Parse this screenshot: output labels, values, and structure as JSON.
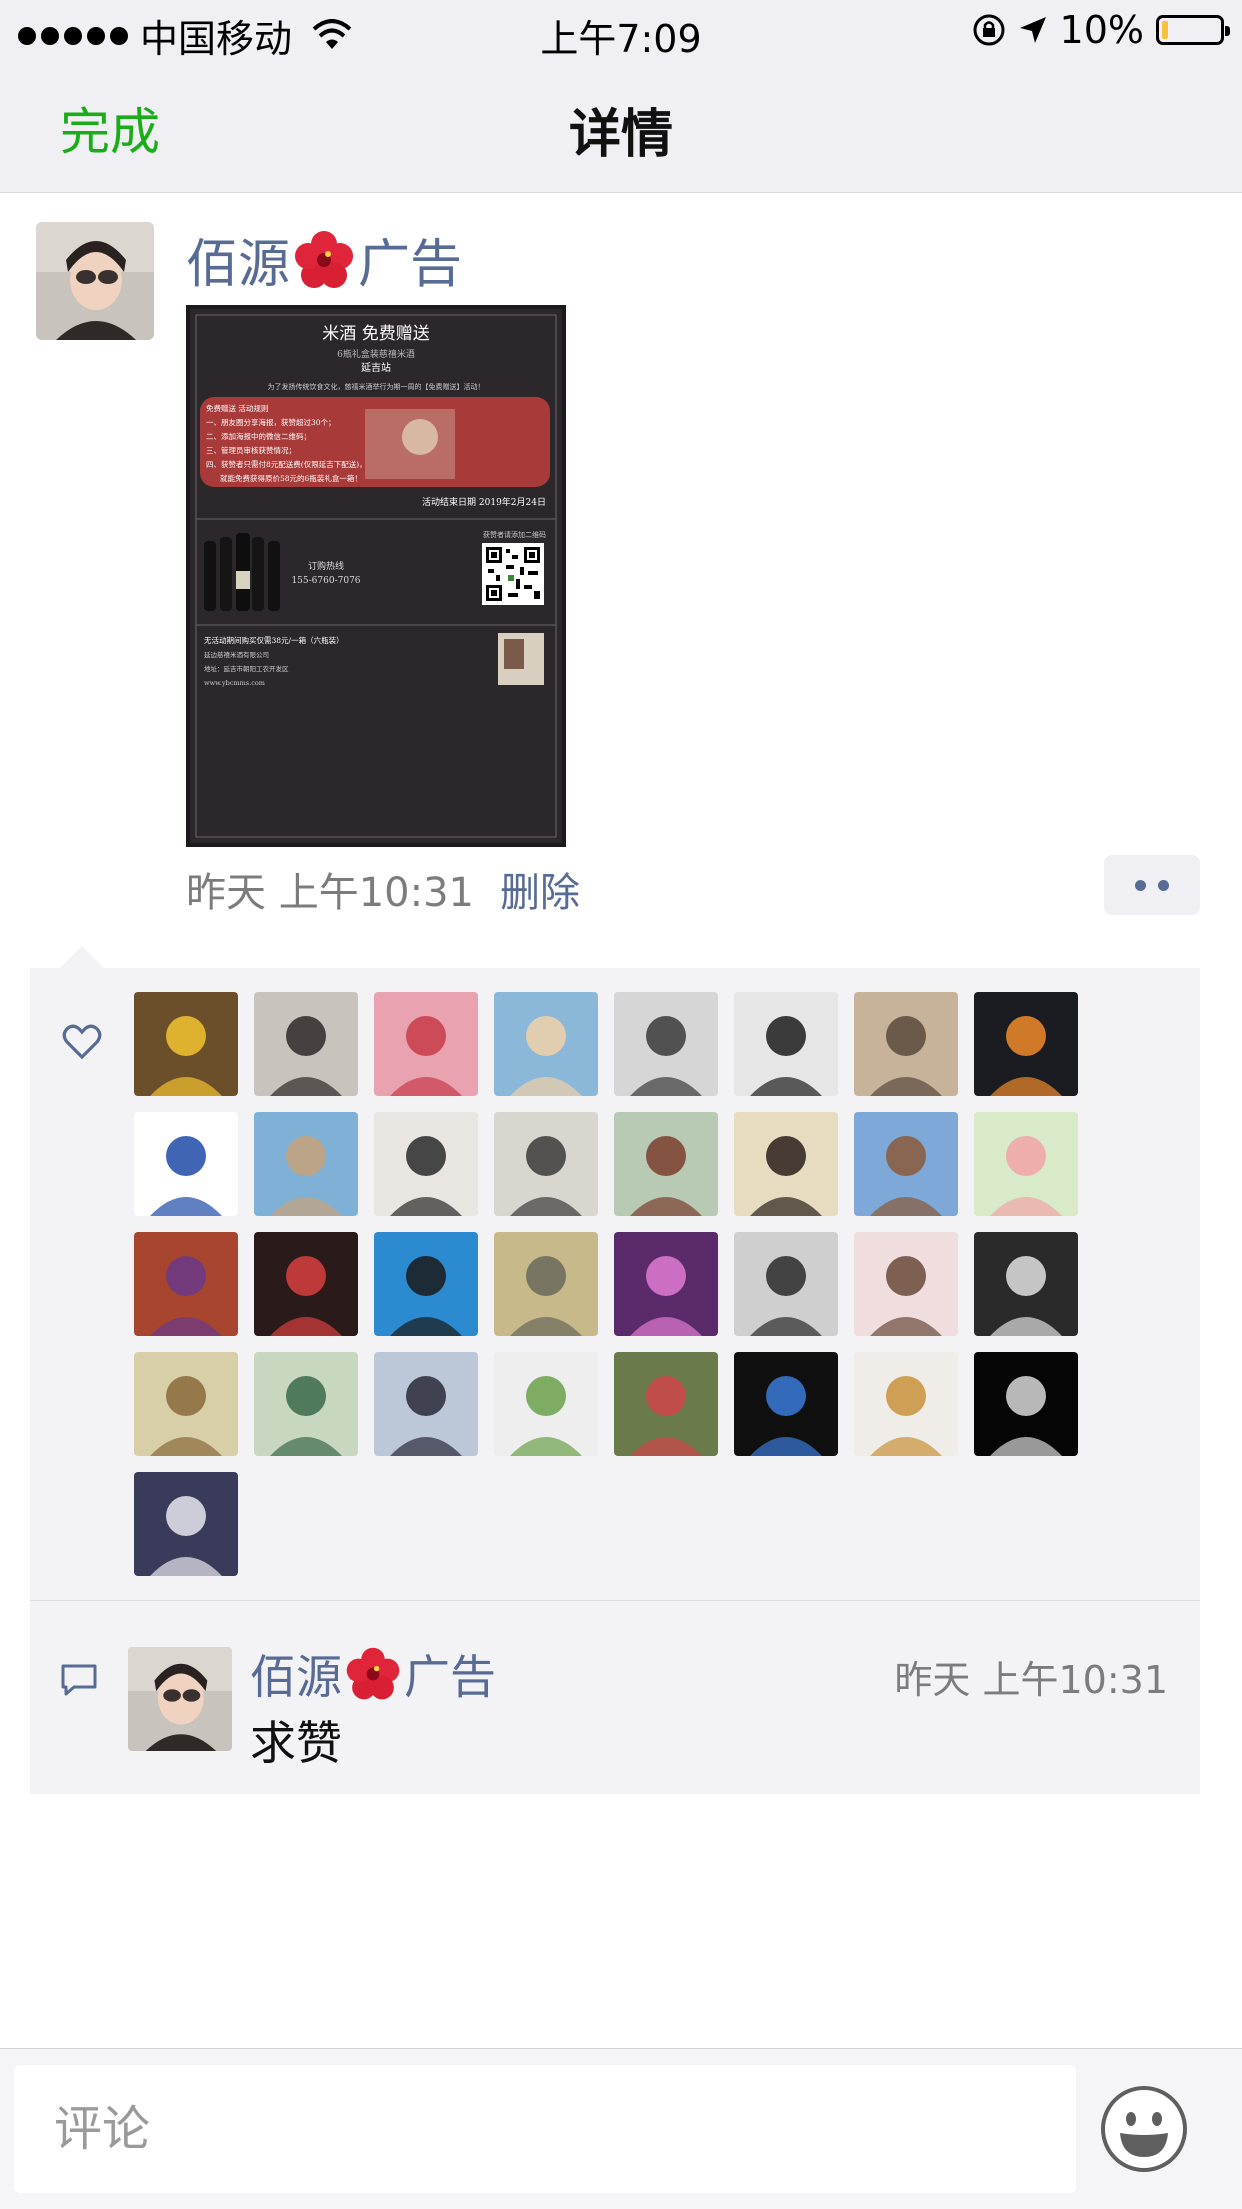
{
  "status_bar": {
    "carrier": "中国移动",
    "time": "上午7:09",
    "battery_percent": "10%",
    "battery_level": 0.1,
    "battery_color": "#f6c23b"
  },
  "nav": {
    "done_label": "完成",
    "title": "详情"
  },
  "post": {
    "author": {
      "name_part1": "佰源",
      "name_part2": "广告"
    },
    "poster_text": {
      "title": "米酒 免费赠送",
      "subtitle": "6瓶礼盒装慈禧米酒",
      "location": "延吉站",
      "intro": "为了发扬传统饮食文化，慈禧米酒举行为期一周的【免费赠送】活动！",
      "rules_title": "免费赠送 活动规则",
      "rule1": "一、朋友圈分享海报，获赞超过30个；",
      "rule2": "二、添加海报中的微信二维码；",
      "rule3": "三、管理员审核获赞情况；",
      "rule4": "四、获赞者只需付8元配送费(仅限延吉下配送)，",
      "rule5": "就能免费获得原价58元的6瓶装礼盒一箱！",
      "end_date": "活动结束日期 2019年2月24日",
      "qr_caption": "获赞者请添加二维码",
      "hotline_label": "订购热线",
      "hotline": "155-6760-7076",
      "bottom_line1": "无活动期间购买仅需38元/一箱（六瓶装）",
      "bottom_line2": "延边慈禧米酒有限公司",
      "bottom_line3": "地址：延吉市朝阳工农开发区",
      "website": "www.ybcmms.com"
    },
    "time": "昨天 上午10:31",
    "delete_label": "删除"
  },
  "likes": {
    "avatar_colors": [
      [
        "#6b4f2a",
        "#f2c230"
      ],
      [
        "#c9c3bd",
        "#2f2a28"
      ],
      [
        "#e8a2b0",
        "#c83b4a"
      ],
      [
        "#8bb8d8",
        "#f0d0a8"
      ],
      [
        "#d6d6d6",
        "#3a3a3a"
      ],
      [
        "#e6e6e6",
        "#1c1c1c"
      ],
      [
        "#c7b39a",
        "#5a4a3c"
      ],
      [
        "#1b1b22",
        "#f08a2a"
      ],
      [
        "#ffffff",
        "#1e4aa8"
      ],
      [
        "#7fb0d6",
        "#c7a27a"
      ],
      [
        "#e9e5e0",
        "#2a2a2a"
      ],
      [
        "#d9d5cf",
        "#3b3b3b"
      ],
      [
        "#b8c9b4",
        "#7a3e2e"
      ],
      [
        "#e8dcc0",
        "#2a1f1a"
      ],
      [
        "#7ea8d8",
        "#8a5a3a"
      ],
      [
        "#d8eac8",
        "#f2a4a4"
      ],
      [
        "#a7452e",
        "#6a3a8a"
      ],
      [
        "#2a1a1a",
        "#d84040"
      ],
      [
        "#2c8ad0",
        "#1a1a1a"
      ],
      [
        "#c7b98a",
        "#6a6a5a"
      ],
      [
        "#5a2a6a",
        "#e07ad0"
      ],
      [
        "#cfcfcf",
        "#2a2a2a"
      ],
      [
        "#f0dede",
        "#6a4a3a"
      ],
      [
        "#2a2a2a",
        "#e0e0e0"
      ],
      [
        "#d8cfa8",
        "#8a6a3a"
      ],
      [
        "#c8d8c0",
        "#3a6a4a"
      ],
      [
        "#bcc8d8",
        "#2a2a3a"
      ],
      [
        "#eeeeee",
        "#6aa04a"
      ],
      [
        "#6a7a4a",
        "#d0454a"
      ],
      [
        "#101010",
        "#3a7ad8"
      ],
      [
        "#f0ede8",
        "#c8903a"
      ],
      [
        "#050505",
        "#d8d8d8"
      ],
      [
        "#3a3a5a",
        "#e8e8f0"
      ]
    ]
  },
  "comment": {
    "author_part1": "佰源",
    "author_part2": "广告",
    "time": "昨天 上午10:31",
    "text": "求赞"
  },
  "input": {
    "placeholder": "评论"
  }
}
